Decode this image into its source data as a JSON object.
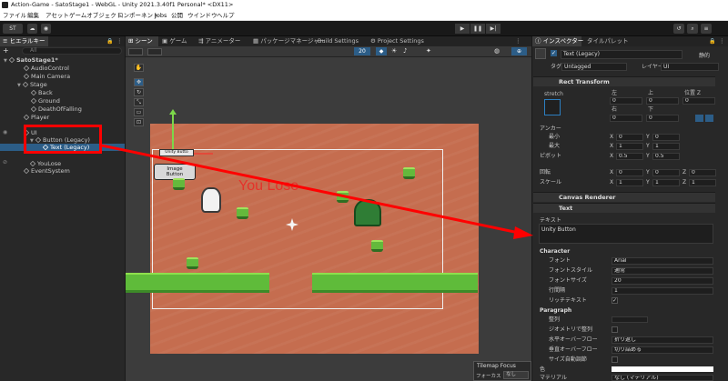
{
  "window": {
    "title": "Action-Game - SatoStage1 - WebGL - Unity 2021.3.40f1 Personal* <DX11>"
  },
  "menu": [
    "ファイル",
    "編集",
    "アセット",
    "ゲームオブジェクト",
    "コンポーネント",
    "Jobs",
    "公開",
    "ウインドウ",
    "ヘルプ"
  ],
  "toolbar": {
    "account": "ST",
    "play": "▶",
    "pause": "❚❚",
    "step": "▶|"
  },
  "hierarchy": {
    "tab": "ヒエラルキー",
    "search_placeholder": "All",
    "add": "+",
    "items": [
      "SatoStage1*",
      "AudioControl",
      "Main Camera",
      "Stage",
      "Back",
      "Ground",
      "DeathOfFalling",
      "Player",
      "UI",
      "Button (Legacy)",
      "Text (Legacy)",
      "YouLose",
      "EventSystem"
    ]
  },
  "scene": {
    "tabs": [
      "シーン",
      "ゲーム",
      "アニメーター",
      "パッケージマネージャー",
      "Build Settings",
      "Project Settings"
    ],
    "layer_count": "20",
    "unity_button": "Unity Butto",
    "image_button": "Image Button",
    "you_lose": "You Lose",
    "tilemap_focus": "Tilemap Focus",
    "focus_label": "フォーカス",
    "focus_value": "なし"
  },
  "inspector": {
    "tabs": [
      "インスペクター",
      "タイルパレット"
    ],
    "name": "Text (Legacy)",
    "static": "静的",
    "tag_label": "タグ",
    "tag": "Untagged",
    "layer_label": "レイヤー",
    "layer": "UI",
    "rect_transform": "Rect Transform",
    "stretch": "stretch",
    "left": "左",
    "top": "上",
    "posz": "位置 Z",
    "right": "右",
    "bottom": "下",
    "left_v": "0",
    "top_v": "0",
    "posz_v": "0",
    "right_v": "0",
    "bottom_v": "0",
    "anchor": "アンカー",
    "min": "最小",
    "max": "最大",
    "pivot": "ピボット",
    "rotation": "回転",
    "scale": "スケール",
    "x": "X",
    "y": "Y",
    "z": "Z",
    "min_x": "0",
    "min_y": "0",
    "max_x": "1",
    "max_y": "1",
    "pivot_x": "0.5",
    "pivot_y": "0.5",
    "rot_x": "0",
    "rot_y": "0",
    "rot_z": "0",
    "scale_x": "1",
    "scale_y": "1",
    "scale_z": "1",
    "canvas_renderer": "Canvas Renderer",
    "text": "Text",
    "text_label": "テキスト",
    "text_value": "Unity Button",
    "character": "Character",
    "font_label": "フォント",
    "font": "Arial",
    "font_style_label": "フォントスタイル",
    "font_style": "通常",
    "font_size_label": "フォントサイズ",
    "font_size": "20",
    "line_spacing_label": "行間隔",
    "line_spacing": "1",
    "rich_text_label": "リッチテキスト",
    "paragraph": "Paragraph",
    "alignment_label": "整列",
    "align_geom_label": "ジオメトリで整列",
    "hoverflow_label": "水平オーバーフロー",
    "hoverflow": "折り返し",
    "voverflow_label": "垂直オーバーフロー",
    "voverflow": "切り詰める",
    "best_fit_label": "サイズ自動調節",
    "color_label": "色",
    "material_label": "マテリアル",
    "material": "なし (マテリアル)"
  }
}
